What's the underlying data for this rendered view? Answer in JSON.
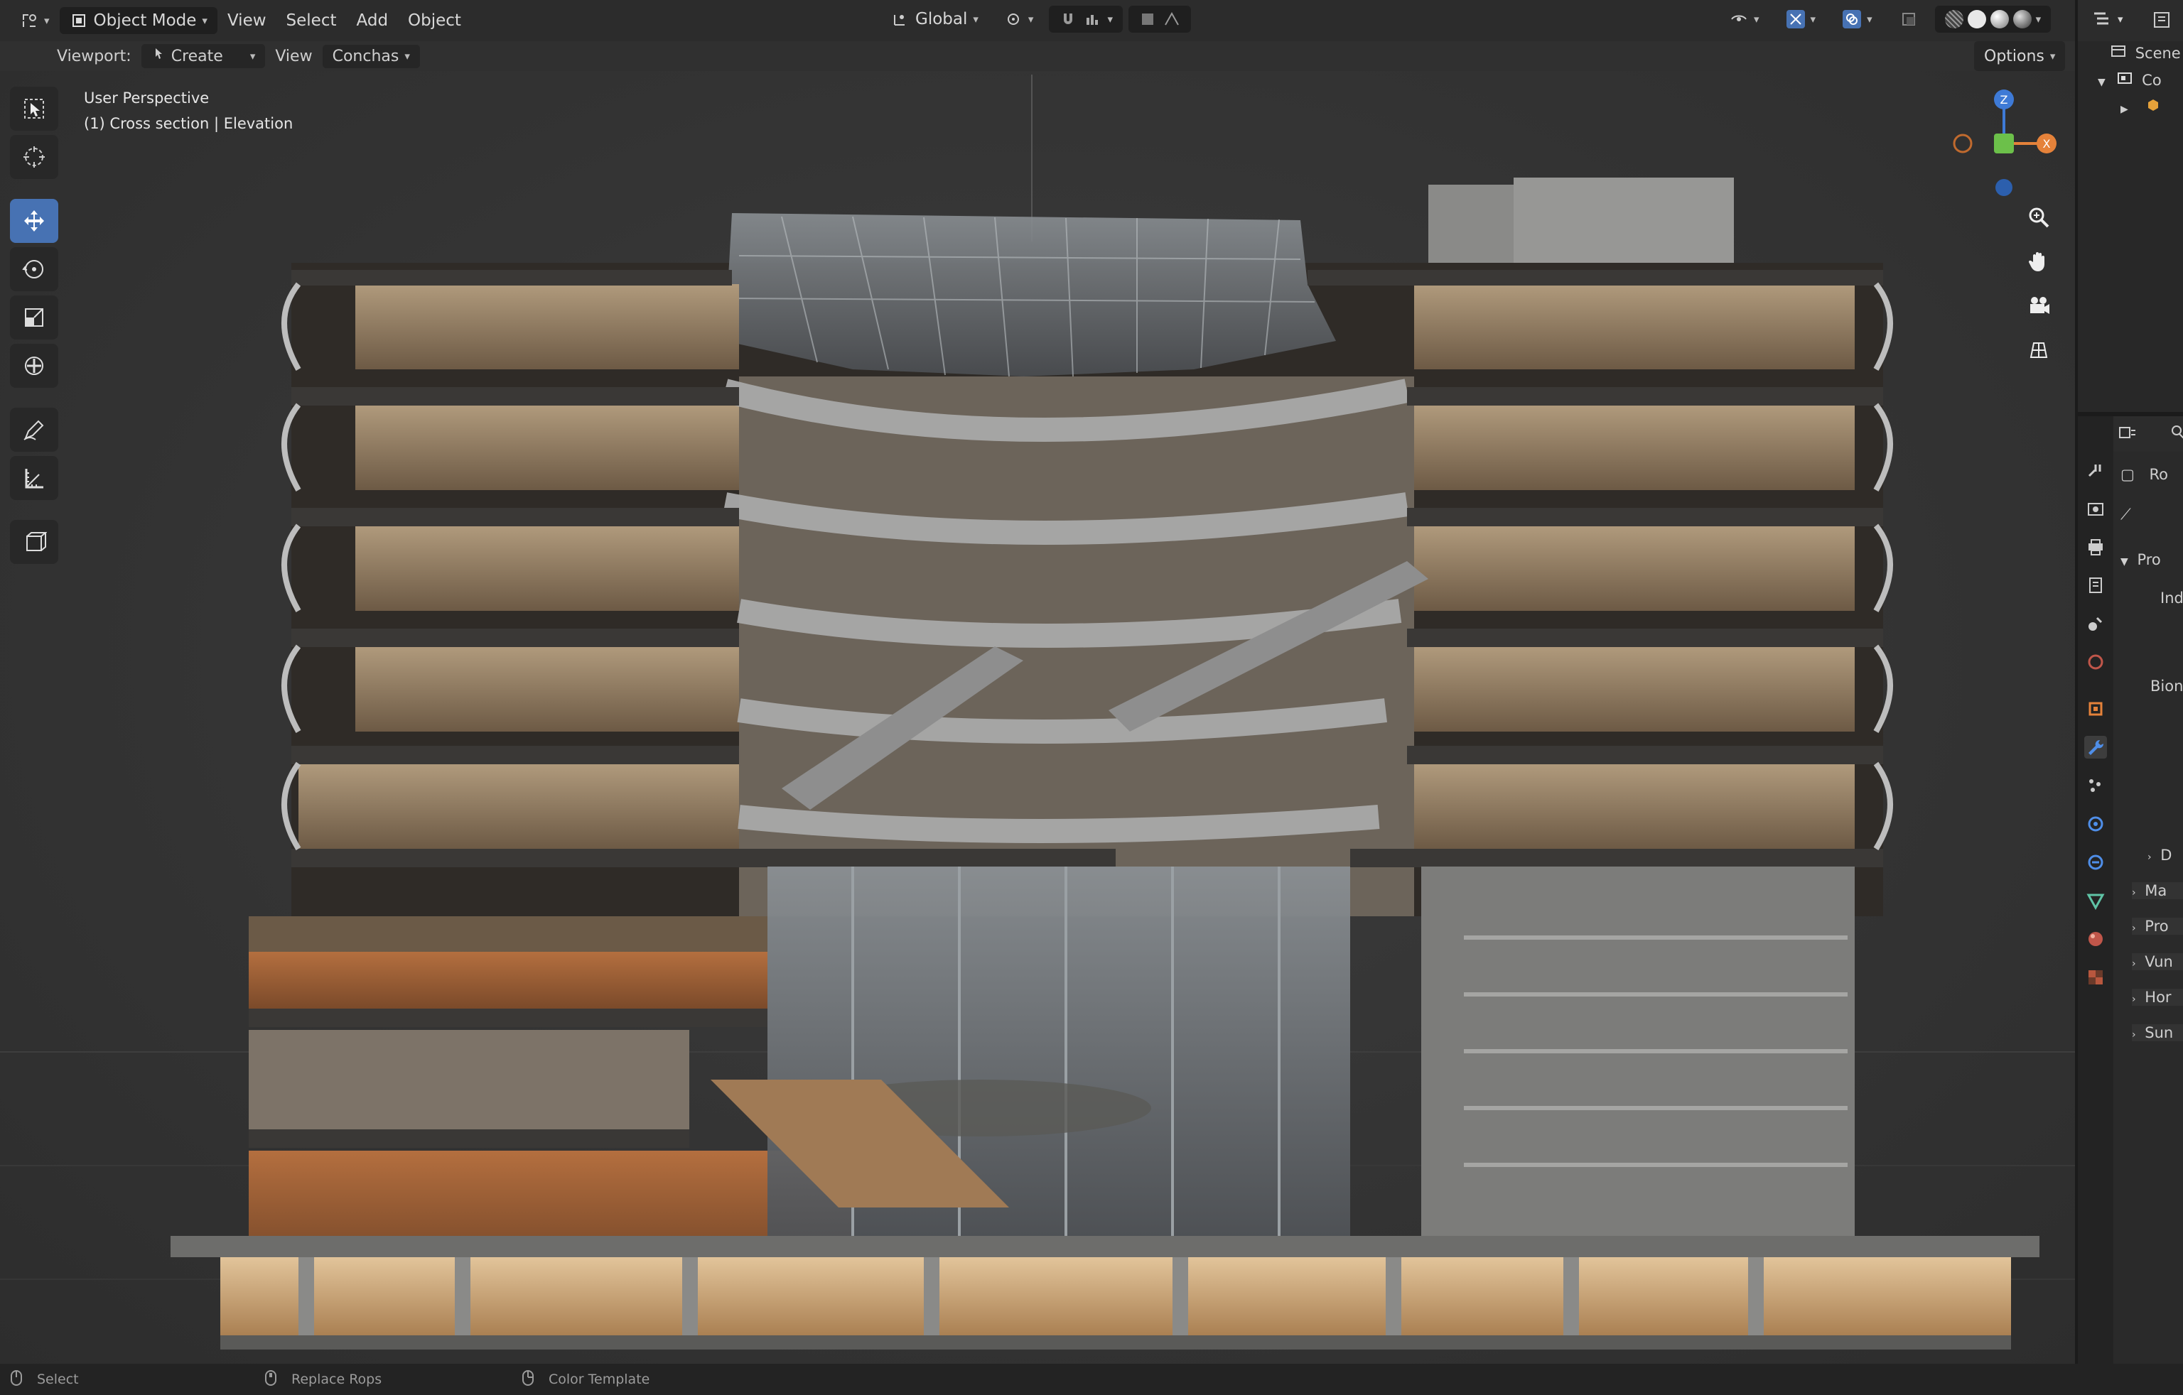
{
  "header": {
    "mode_label": "Object Mode",
    "menus": [
      "View",
      "Select",
      "Add",
      "Object"
    ],
    "transform_orientation": "Global"
  },
  "subheader": {
    "viewport_label": "Viewport:",
    "create_label": "Create",
    "view_label": "View",
    "shading_label": "Conchas",
    "options_label": "Options"
  },
  "viewport": {
    "view_name": "User Perspective",
    "collection_path": "(1) Cross section | Elevation"
  },
  "outliner": {
    "title": "Scene",
    "row1": "Co"
  },
  "properties": {
    "rows": [
      "Ro",
      "Pro",
      "Ind",
      "Bion",
      "D",
      "Ma",
      "Pro",
      "Vun",
      "Hor",
      "Sun"
    ]
  },
  "statusbar": {
    "select_label": "Select",
    "middle_label": "Replace Rops",
    "context_label": "Color Template"
  },
  "colors": {
    "accent_blue": "#4772b3",
    "gizmo_x": "#e5823a",
    "gizmo_y": "#6cc04a",
    "gizmo_z": "#3e7ad6"
  }
}
